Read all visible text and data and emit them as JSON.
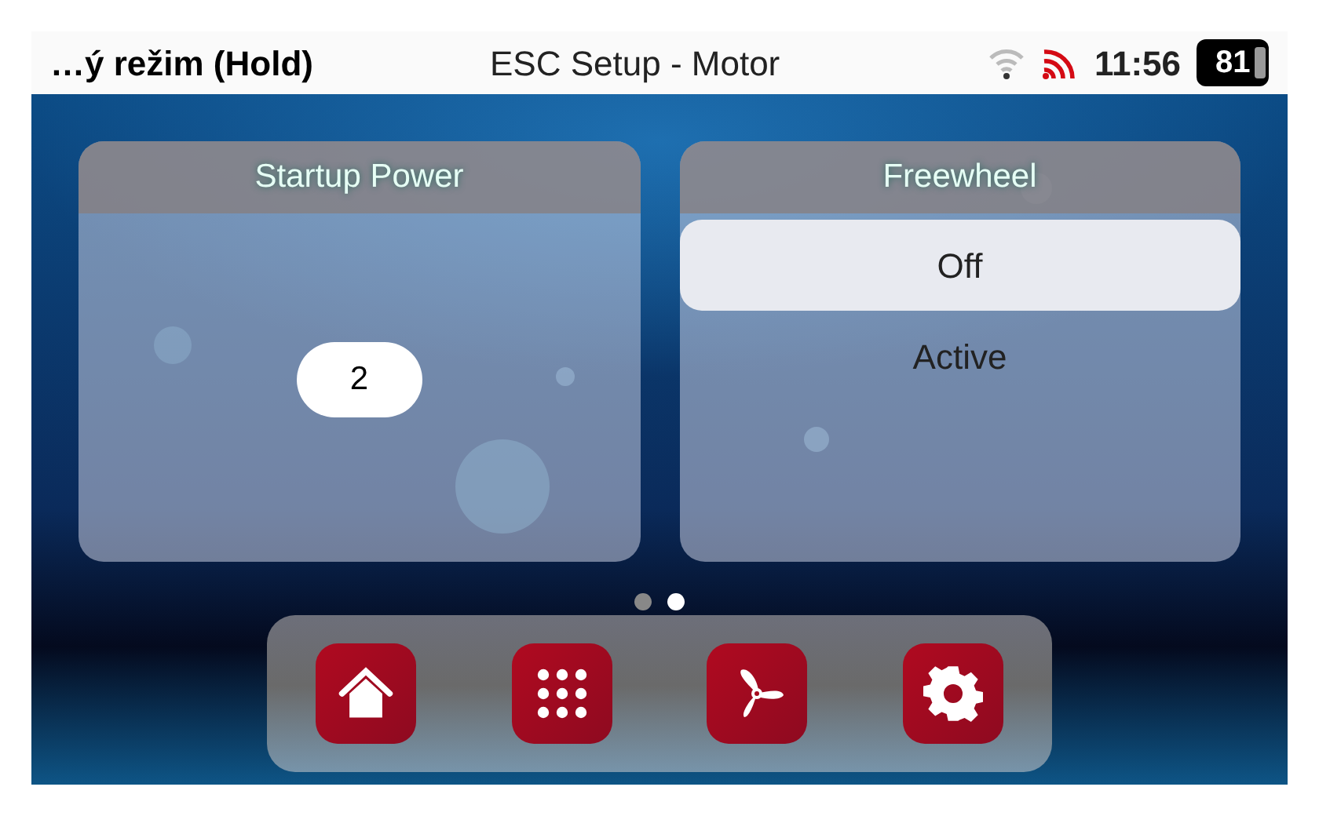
{
  "status_bar": {
    "mode": "…ý režim (Hold)",
    "title": "ESC Setup - Motor",
    "time": "11:56",
    "battery": "81"
  },
  "panels": [
    {
      "kind": "value",
      "title": "Startup Power",
      "value": "2"
    },
    {
      "kind": "options",
      "title": "Freewheel",
      "options": [
        {
          "label": "Off",
          "selected": true
        },
        {
          "label": "Active",
          "selected": false
        }
      ]
    }
  ],
  "pages": [
    {
      "selected": false
    },
    {
      "selected": true
    }
  ],
  "dock": [
    {
      "kind": "home"
    },
    {
      "kind": "apps"
    },
    {
      "kind": "fan"
    },
    {
      "kind": "settings"
    }
  ]
}
